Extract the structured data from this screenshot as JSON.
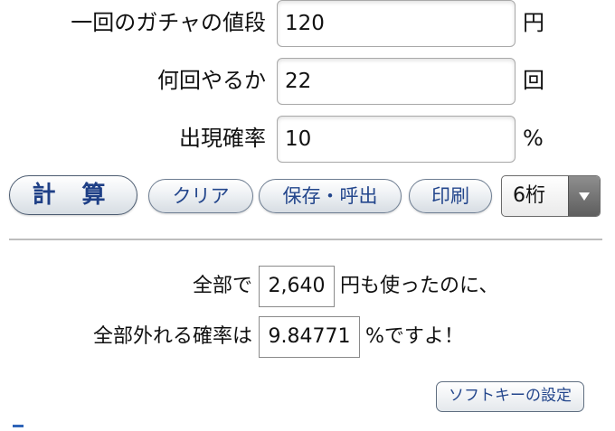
{
  "form": {
    "price": {
      "label": "一回のガチャの値段",
      "value": "120",
      "unit": "円"
    },
    "count": {
      "label": "何回やるか",
      "value": "22",
      "unit": "回"
    },
    "rate": {
      "label": "出現確率",
      "value": "10",
      "unit": "%"
    }
  },
  "buttons": {
    "calculate": "計 算",
    "clear": "クリア",
    "save_recall": "保存・呼出",
    "print": "印刷"
  },
  "digits_select": {
    "selected": "6桁"
  },
  "result": {
    "line1_prefix": "全部で",
    "total_spent": "2,640",
    "line1_suffix": "円も使ったのに、",
    "line2_prefix": "全部外れる確率は",
    "miss_probability": "9.84771",
    "line2_suffix": "%ですよ！"
  },
  "softkey": {
    "label": "ソフトキーの設定"
  },
  "colors": {
    "button_text": "#23468c",
    "divider": "#bdbdbd",
    "select_arrow": "#5e5e5e"
  }
}
